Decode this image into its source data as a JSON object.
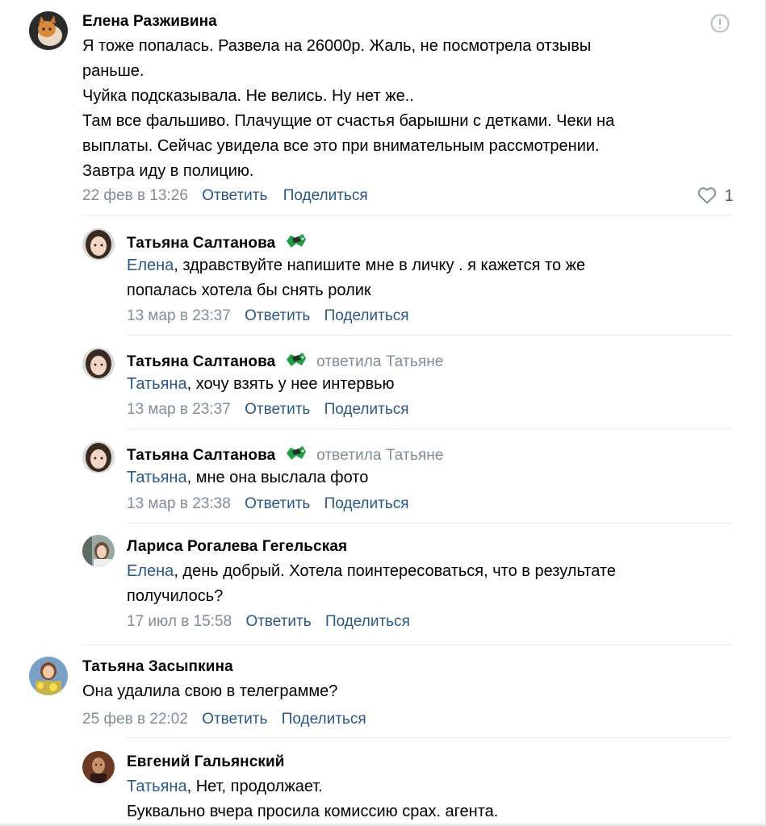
{
  "comments": [
    {
      "author": "Елена Разживина",
      "lines": [
        "Я тоже попалась. Развела на 26000р. Жаль, не посмотрела отзывы",
        "раньше.",
        "Чуйка подсказывала. Не велись. Ну нет же..",
        "Там все фальшиво. Плачущие от счастья барышни с детками. Чеки на",
        "выплаты. Сейчас увидела все это при внимательным рассмотрении.",
        "Завтра иду в полицию."
      ],
      "date": "22 фев в 13:26",
      "reply_label": "Ответить",
      "share_label": "Поделиться",
      "likes": "1"
    },
    {
      "author": "Татьяна Салтанова",
      "mention": "Елена",
      "lines": [
        ", здравствуйте напишите мне в личку . я кажется то же",
        "попалась хотела бы снять ролик"
      ],
      "date": "13 мар в 23:37",
      "reply_label": "Ответить",
      "share_label": "Поделиться"
    },
    {
      "author": "Татьяна Салтанова",
      "replied_to": "ответила Татьяне",
      "mention": "Татьяна",
      "lines": [
        ", хочу взять у нее интервью"
      ],
      "date": "13 мар в 23:37",
      "reply_label": "Ответить",
      "share_label": "Поделиться"
    },
    {
      "author": "Татьяна Салтанова",
      "replied_to": "ответила Татьяне",
      "mention": "Татьяна",
      "lines": [
        ", мне она выслала фото"
      ],
      "date": "13 мар в 23:38",
      "reply_label": "Ответить",
      "share_label": "Поделиться"
    },
    {
      "author": "Лариса Рогалева Гегельская",
      "mention": "Елена",
      "lines": [
        ", день добрый. Хотела поинтересоваться, что в результате",
        "получилось?"
      ],
      "date": "17 июл в 15:58",
      "reply_label": "Ответить",
      "share_label": "Поделиться"
    },
    {
      "author": "Татьяна Засыпкина",
      "lines": [
        "Она удалила свою в телеграмме?"
      ],
      "date": "25 фев в 22:02",
      "reply_label": "Ответить",
      "share_label": "Поделиться"
    },
    {
      "author": "Евгений Гальянский",
      "mention": "Татьяна",
      "lines": [
        ", Нет, продолжает.",
        "Буквально вчера просила комиссию срах. агента."
      ]
    }
  ],
  "icons": {
    "report": "report-icon",
    "like": "heart-icon",
    "badge": "gamepad-icon"
  },
  "colors": {
    "link": "#2a5885",
    "secondary": "#818c99",
    "divider": "#e7e8ec"
  }
}
